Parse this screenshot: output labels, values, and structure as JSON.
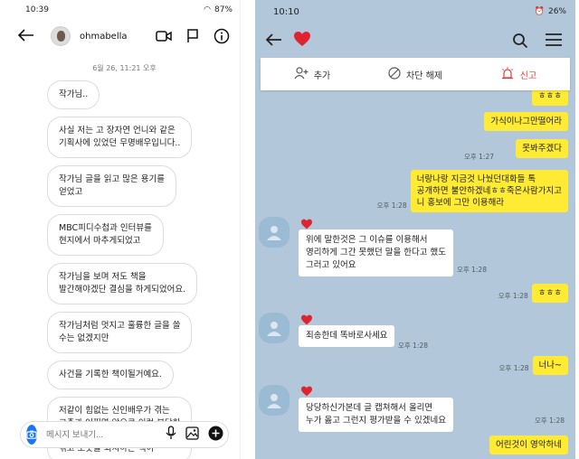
{
  "left": {
    "status_time": "10:39",
    "status_right": "87%",
    "username": "ohmabella",
    "timestamp": "6월 26, 11:21 오후",
    "messages": [
      "작가님..",
      "사실 저는 고 장자연 언니와 같은\n기획사에 있었던 무명배우입니다..",
      "작가님 글을 읽고 많은 용기를\n얻었고",
      "MBC피디수첩과 인터뷰를\n현지에서 마추게되었고",
      "작가님을 보며 저도 책을\n발간해야겠단 결심을 하게되었어요.",
      "작가님처럼 멋지고 훌륭한 글을 쓸\n수는 없겠지만",
      "사건을 기록한 책이될거예요.",
      "저같이 힘없는 신인배우가 겪는\n고충과 어쩌면 앞으로 이런 부당한\n일을 겪어내야할 분들 혹은 이미\n겪고 보듯을 외쳐하는 책이"
    ],
    "composer_placeholder": "메시지 보내기...",
    "colors": {
      "camera": "#1877f2"
    }
  },
  "right": {
    "status_time": "10:10",
    "status_right": "26%",
    "blockbar": {
      "add": "추가",
      "unblock": "차단 해제",
      "report": "신고"
    },
    "messages": {
      "m1": "ㅎㅎㅎ",
      "m2": "가식이나그만떨어라",
      "m3": "못봐주겠다",
      "m4": "너랑나랑 지금것 나눴던대화들 톡\n공개하면 불안하겠네ㅎㅎ죽은사람가지고\n니 홍보에 그만 이용해라",
      "t1": "위에 말한것은 그 이슈를 이용해서\n영리하게 그간 못했던 말을 한다고 했도\n그러고 있어요",
      "m5": "ㅎㅎㅎ",
      "t2": "죄송한데 똑바로사세요",
      "m6": "너나~",
      "t3": "당당하신가본데 글 캡쳐해서 올리면\n누가 옳고 그런지 평가받을 수 있겠네요",
      "m7": "어린것이 영악하네"
    },
    "times": {
      "m3": "오후 1:27",
      "m4": "오후 1:28",
      "t1": "오후 1:28",
      "m5": "오후 1:28",
      "t2": "오후 1:28",
      "m6": "오후 1:28",
      "t3": "오후 1:28"
    },
    "colors": {
      "background": "#b2c7d9",
      "my_bubble": "#ffeb33",
      "heart": "#e0232e",
      "report": "#e53935"
    }
  }
}
